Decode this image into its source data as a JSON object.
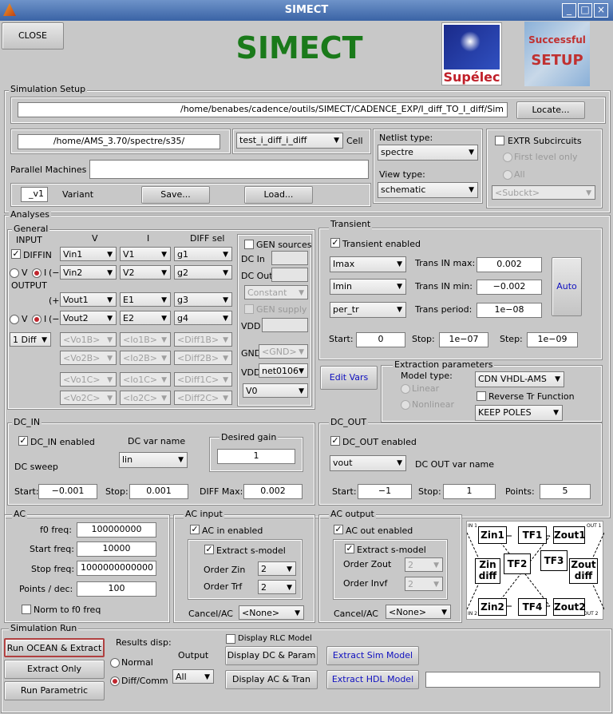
{
  "window": {
    "title": "SIMECT",
    "min": "_",
    "max": "□",
    "close": "×"
  },
  "header": {
    "close_label": "CLOSE",
    "app_title": "SIMECT",
    "logo1_text": "Supélec",
    "logo2_text_a": "Successful",
    "logo2_text_b": "SETUP"
  },
  "sim_setup": {
    "title": "Simulation Setup",
    "path": "/home/benabes/cadence/outils/SIMECT/CADENCE_EXP/I_diff_TO_I_diff/Sim",
    "locate": "Locate...",
    "spectre_path": "/home/AMS_3.70/spectre/s35/",
    "cell": "test_i_diff_i_diff",
    "cell_label": "Cell",
    "netlist_label": "Netlist type:",
    "netlist_value": "spectre",
    "view_label": "View type:",
    "view_value": "schematic",
    "extr_label": "EXTR Subcircuits",
    "first_level": "First level only",
    "all": "All",
    "subckt": "<Subckt>",
    "parallel_label": "Parallel Machines",
    "parallel_value": "",
    "variant_value": "_v1",
    "variant_label": "Variant",
    "save": "Save...",
    "load": "Load..."
  },
  "analyses": {
    "title": "Analyses"
  },
  "general": {
    "title": "General",
    "input": "INPUT",
    "col_v": "V",
    "col_i": "I",
    "col_diff": "DIFF sel",
    "diffin": "DIFFIN",
    "v": "V",
    "i": "I",
    "plus": "(+)",
    "minus": "(−)",
    "output": "OUTPUT",
    "diff_mode": "1 Diff",
    "rows": [
      [
        "Vin1",
        "V1",
        "g1"
      ],
      [
        "Vin2",
        "V2",
        "g2"
      ],
      [
        "Vout1",
        "E1",
        "g3"
      ],
      [
        "Vout2",
        "E2",
        "g4"
      ]
    ],
    "dis_rows": [
      [
        "<Vo1B>",
        "<Io1B>",
        "<Diff1B>"
      ],
      [
        "<Vo2B>",
        "<Io2B>",
        "<Diff2B>"
      ],
      [
        "<Vo1C>",
        "<Io1C>",
        "<Diff1C>"
      ],
      [
        "<Vo2C>",
        "<Io2C>",
        "<Diff2C>"
      ]
    ],
    "gen_sources": "GEN sources",
    "dc_in": "DC In",
    "dc_out": "DC Out",
    "constant": "Constant",
    "gen_supply": "GEN supply",
    "vdd": "VDD",
    "gnd": "GND",
    "gnd_val": "<GND>",
    "vdd_val": "net0106",
    "v0": "V0"
  },
  "transient": {
    "title": "Transient",
    "enabled": "Transient enabled",
    "s1": "Imax",
    "s2": "Imin",
    "s3": "per_tr",
    "l1": "Trans IN max:",
    "v1": "0.002",
    "l2": "Trans IN min:",
    "v2": "−0.002",
    "l3": "Trans period:",
    "v3": "1e−08",
    "auto": "Auto",
    "start_l": "Start:",
    "start": "0",
    "stop_l": "Stop:",
    "stop": "1e−07",
    "step_l": "Step:",
    "step": "1e−09"
  },
  "extraction": {
    "edit_vars": "Edit Vars",
    "title": "Extraction parameters",
    "model_type": "Model type:",
    "linear": "Linear",
    "nonlinear": "Nonlinear",
    "model_value": "CDN VHDL-AMS",
    "reverse": "Reverse Tr Function",
    "poles": "KEEP POLES"
  },
  "dc_in": {
    "title": "DC_IN",
    "enabled": "DC_IN enabled",
    "varname_label": "DC var name",
    "var": "lin",
    "sweep": "DC sweep",
    "gain_label": "Desired gain",
    "gain": "1",
    "start_l": "Start:",
    "start": "−0.001",
    "stop_l": "Stop:",
    "stop": "0.001",
    "diffmax_l": "DIFF Max:",
    "diffmax": "0.002"
  },
  "dc_out": {
    "title": "DC_OUT",
    "enabled": "DC_OUT enabled",
    "var": "vout",
    "varname_label": "DC OUT var name",
    "start_l": "Start:",
    "start": "−1",
    "stop_l": "Stop:",
    "stop": "1",
    "points_l": "Points:",
    "points": "5"
  },
  "ac": {
    "title": "AC",
    "f0_l": "f0 freq:",
    "f0": "100000000",
    "start_l": "Start freq:",
    "start": "10000",
    "stop_l": "Stop freq:",
    "stop": "1000000000000",
    "pts_l": "Points / dec:",
    "pts": "100",
    "norm": "Norm to f0 freq"
  },
  "ac_input": {
    "title": "AC input",
    "enabled": "AC in enabled",
    "extract": "Extract s-model",
    "order_zin": "Order Zin",
    "zin": "2",
    "order_trf": "Order Trf",
    "trf": "2",
    "cancel_l": "Cancel/AC",
    "cancel": "<None>"
  },
  "ac_output": {
    "title": "AC output",
    "enabled": "AC out enabled",
    "extract": "Extract s-model",
    "order_zout": "Order Zout",
    "zout": "2",
    "order_invf": "Order Invf",
    "invf": "2",
    "cancel_l": "Cancel/AC",
    "cancel": "<None>"
  },
  "diagram": {
    "zin1": "Zin1",
    "tf1": "TF1",
    "zout1": "Zout1",
    "tf2": "TF2",
    "tf3": "TF3",
    "zindiff_a": "Zin",
    "zindiff_b": "diff",
    "zoutdiff_a": "Zout",
    "zoutdiff_b": "diff",
    "zin2": "Zin2",
    "tf4": "TF4",
    "zout2": "Zout2",
    "in1": "IN 1",
    "out1": "OUT 1",
    "in2": "IN 2",
    "out2": "OUT 2"
  },
  "run": {
    "title": "Simulation Run",
    "ocean": "Run OCEAN & Extract",
    "extract_only": "Extract Only",
    "parametric": "Run Parametric",
    "results_disp": "Results disp:",
    "normal": "Normal",
    "diffcomm": "Diff/Comm",
    "output_l": "Output",
    "output": "All",
    "rlc": "Display RLC Model",
    "disp_dc": "Display DC & Param",
    "disp_ac": "Display AC & Tran",
    "extract_sim": "Extract Sim Model",
    "extract_hdl": "Extract HDL Model",
    "hdl_value": ""
  }
}
